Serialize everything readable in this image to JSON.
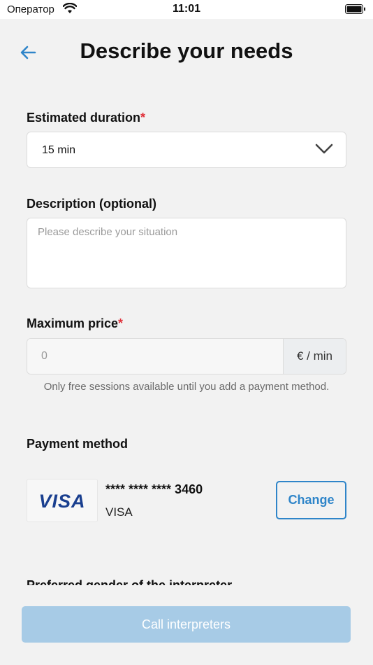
{
  "status_bar": {
    "carrier": "Оператор",
    "time": "11:01"
  },
  "header": {
    "title": "Describe your needs",
    "back_icon": "arrow-left-icon"
  },
  "duration": {
    "label": "Estimated duration",
    "required_mark": "*",
    "value": "15 min"
  },
  "description": {
    "label": "Description (optional)",
    "placeholder": "Please describe your situation",
    "value": ""
  },
  "max_price": {
    "label": "Maximum price",
    "required_mark": "*",
    "placeholder": "0",
    "unit": "€ / min",
    "hint": "Only free sessions available until you add a payment method."
  },
  "payment": {
    "label": "Payment method",
    "card_logo_text": "VISA",
    "card_number": "**** **** **** 3460",
    "card_brand": "VISA",
    "change_label": "Change"
  },
  "gender": {
    "label": "Preferred gender of the interpreter"
  },
  "footer": {
    "call_label": "Call interpreters"
  },
  "colors": {
    "accent": "#2f85c9",
    "required": "#e0303a",
    "disabled_button": "#a7cbe6",
    "background": "#f2f2f2"
  }
}
